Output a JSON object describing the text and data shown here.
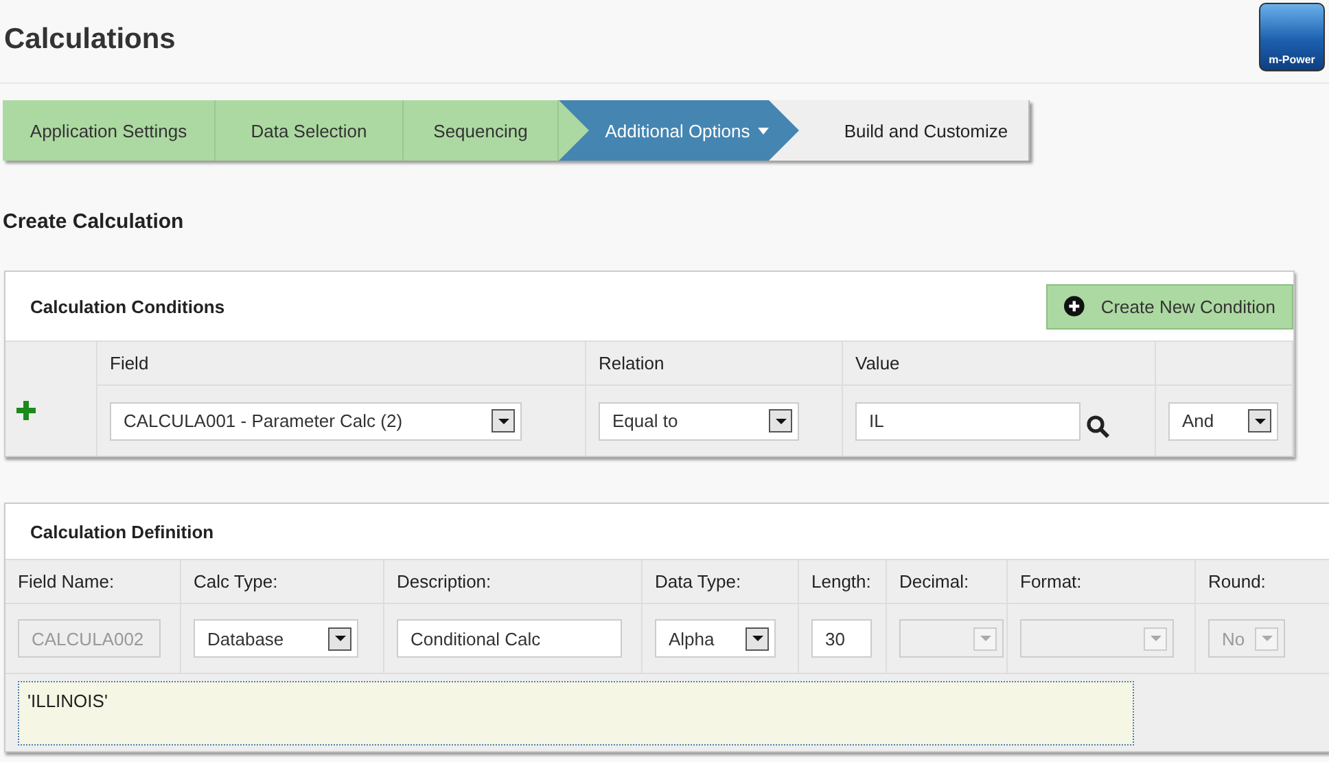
{
  "page_title": "Calculations",
  "logo": {
    "text": "m-Power"
  },
  "steps": [
    {
      "label": "Application Settings",
      "selected": false,
      "has_menu": false
    },
    {
      "label": "Data Selection",
      "selected": false,
      "has_menu": false
    },
    {
      "label": "Sequencing",
      "selected": false,
      "has_menu": false
    },
    {
      "label": "Additional Options",
      "selected": true,
      "has_menu": true
    },
    {
      "label": "Build and Customize",
      "selected": false,
      "has_menu": false
    }
  ],
  "section_title": "Create Calculation",
  "conditions": {
    "title": "Calculation Conditions",
    "button": "Create New Condition",
    "columns": [
      "Field",
      "Relation",
      "Value",
      ""
    ],
    "row": [
      {
        "kind": "select",
        "value": "CALCULA001 - Parameter Calc (2)",
        "disabled": false
      },
      {
        "kind": "select",
        "value": "Equal to",
        "disabled": false
      },
      {
        "kind": "lookup",
        "value": "IL",
        "disabled": false
      },
      {
        "kind": "select",
        "value": "And",
        "disabled": false
      }
    ]
  },
  "definition": {
    "title": "Calculation Definition",
    "columns": [
      "Field Name:",
      "Calc Type:",
      "Description:",
      "Data Type:",
      "Length:",
      "Decimal:",
      "Format:",
      "Round:"
    ],
    "row": [
      {
        "kind": "text",
        "value": "CALCULA002",
        "disabled": true
      },
      {
        "kind": "select",
        "value": "Database",
        "disabled": false
      },
      {
        "kind": "text",
        "value": "Conditional Calc",
        "disabled": false
      },
      {
        "kind": "select",
        "value": "Alpha",
        "disabled": false
      },
      {
        "kind": "text",
        "value": "30",
        "disabled": false
      },
      {
        "kind": "select",
        "disabled": true
      },
      {
        "kind": "select",
        "disabled": true
      },
      {
        "kind": "select",
        "value": "No",
        "disabled": true
      }
    ],
    "expression": "'ILLINOIS'"
  }
}
